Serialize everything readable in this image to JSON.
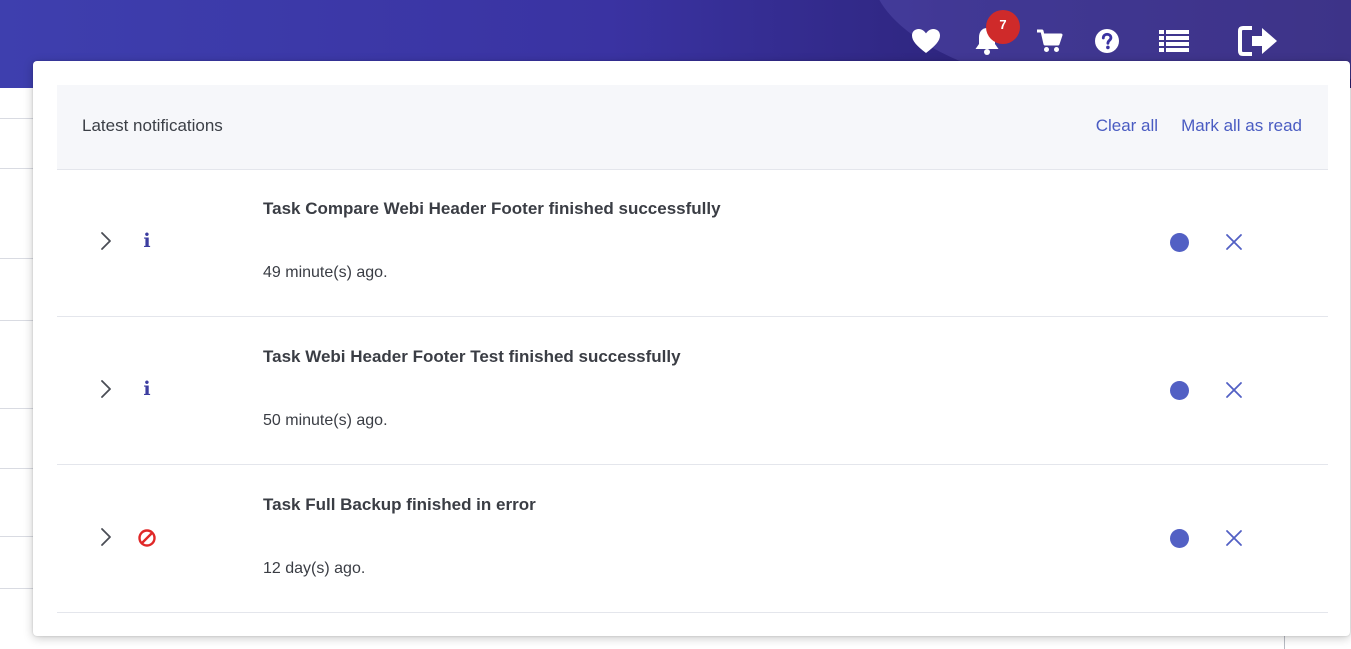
{
  "topbar": {
    "icons": [
      "heart-icon",
      "bell-icon",
      "cart-icon",
      "help-icon",
      "list-icon",
      "logout-icon"
    ],
    "notification_count": "7"
  },
  "panel": {
    "title": "Latest notifications",
    "clear_all": "Clear all",
    "mark_all_read": "Mark all as read"
  },
  "notifications": [
    {
      "title": "Task Compare Webi Header Footer finished successfully",
      "time": "49 minute(s) ago.",
      "icon": "info-icon"
    },
    {
      "title": "Task Webi Header Footer Test finished successfully",
      "time": "50 minute(s) ago.",
      "icon": "info-icon"
    },
    {
      "title": "Task Full Backup finished in error",
      "time": "12 day(s) ago.",
      "icon": "error-icon"
    }
  ],
  "colors": {
    "topbar": "#3a33a2",
    "link": "#4a5cc2",
    "unread_dot": "#5260c4",
    "badge": "#cf2a2a",
    "error": "#e02828"
  }
}
